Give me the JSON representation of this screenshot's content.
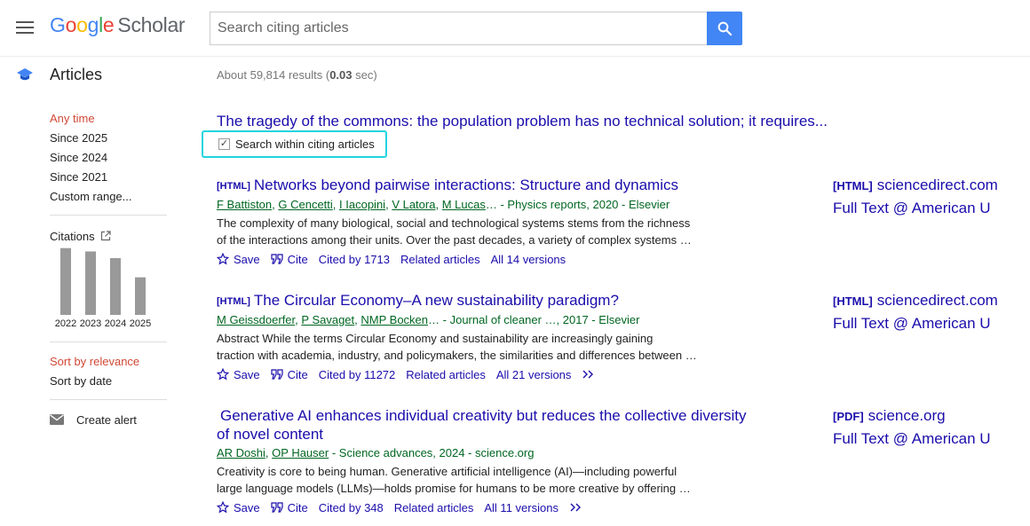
{
  "header": {
    "logo_letters": [
      "G",
      "o",
      "o",
      "g",
      "l",
      "e"
    ],
    "logo_suffix": "Scholar",
    "search_placeholder": "Search citing articles"
  },
  "subheader": {
    "section_label": "Articles",
    "results_prefix": "About 59,814 results (",
    "results_time": "0.03",
    "results_suffix": " sec)"
  },
  "sidebar": {
    "time_filters": [
      "Any time",
      "Since 2025",
      "Since 2024",
      "Since 2021",
      "Custom range..."
    ],
    "active_time_filter": "Any time",
    "citations_label": "Citations",
    "sort_options": [
      "Sort by relevance",
      "Sort by date"
    ],
    "active_sort": "Sort by relevance",
    "create_alert_label": "Create alert"
  },
  "chart_data": {
    "type": "bar",
    "categories": [
      "2022",
      "2023",
      "2024",
      "2025"
    ],
    "values": [
      80,
      76,
      68,
      45
    ],
    "ylim": [
      0,
      85
    ],
    "grid": false,
    "bar_color": "#999999"
  },
  "cited_article": {
    "title": "The tragedy of the commons: the population problem has no technical solution; it requires...",
    "search_within_label": "Search within citing articles",
    "search_within_checked": "✓"
  },
  "results": [
    {
      "tag": "[HTML]",
      "title": "Networks beyond pairwise interactions: Structure and dynamics",
      "authors": [
        "F Battiston",
        "G Cencetti",
        "I Iacopini",
        "V Latora",
        "M Lucas"
      ],
      "venue": "… - Physics reports, 2020 - Elsevier",
      "snippet_lines": [
        "The complexity of many biological, social and technological systems stems from the richness",
        "of the interactions among their units. Over the past decades, a variety of complex systems …"
      ],
      "save_label": "Save",
      "cite_label": "Cite",
      "cited_by": "Cited by 1713",
      "related": "Related articles",
      "versions": "All 14 versions",
      "side_tag": "[HTML]",
      "side_source": "sciencedirect.com",
      "side_fulltext": "Full Text @ American U"
    },
    {
      "tag": "[HTML]",
      "title": "The Circular Economy–A new sustainability paradigm?",
      "authors": [
        "M Geissdoerfer",
        "P Savaget",
        "NMP Bocken"
      ],
      "venue": "… - Journal of cleaner …, 2017 - Elsevier",
      "snippet_lines": [
        "Abstract While the terms Circular Economy and sustainability are increasingly gaining",
        "traction with academia, industry, and policymakers, the similarities and differences between …"
      ],
      "save_label": "Save",
      "cite_label": "Cite",
      "cited_by": "Cited by 11272",
      "related": "Related articles",
      "versions": "All 21 versions",
      "side_tag": "[HTML]",
      "side_source": "sciencedirect.com",
      "side_fulltext": "Full Text @ American U"
    },
    {
      "tag": "",
      "title": "Generative AI enhances individual creativity but reduces the collective diversity of novel content",
      "authors": [
        "AR Doshi",
        "OP Hauser"
      ],
      "venue": " - Science advances, 2024 - science.org",
      "snippet_lines": [
        "Creativity is core to being human. Generative artificial intelligence (AI)—including powerful",
        "large language models (LLMs)—holds promise for humans to be more creative by offering …"
      ],
      "save_label": "Save",
      "cite_label": "Cite",
      "cited_by": "Cited by 348",
      "related": "Related articles",
      "versions": "All 11 versions",
      "side_tag": "[PDF]",
      "side_source": "science.org",
      "side_fulltext": "Full Text @ American U"
    }
  ]
}
